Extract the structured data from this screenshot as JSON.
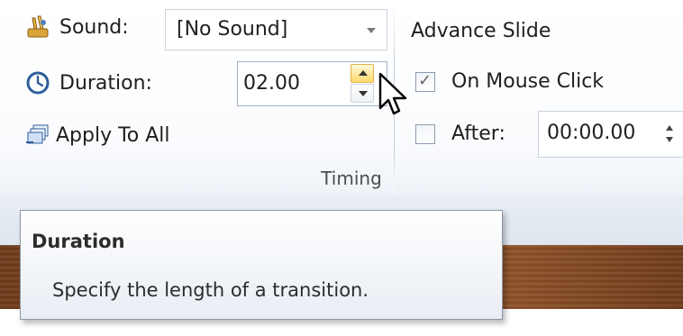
{
  "timing_group": {
    "label": "Timing",
    "sound": {
      "label": "Sound:",
      "value": "[No Sound]",
      "icon": "sound-icon"
    },
    "duration": {
      "label": "Duration:",
      "value": "02.00",
      "icon": "clock-icon"
    },
    "apply_all": {
      "label": "Apply To All",
      "icon": "apply-to-all-icon"
    },
    "advance": {
      "heading": "Advance Slide",
      "on_mouse_click": {
        "label": "On Mouse Click",
        "checked": true
      },
      "after": {
        "label": "After:",
        "checked": false,
        "value": "00:00.00"
      }
    }
  },
  "tooltip": {
    "title": "Duration",
    "body": "Specify the length of a transition."
  },
  "colors": {
    "accent_spin": "#ffd96b",
    "wood": "#8a4c24"
  }
}
